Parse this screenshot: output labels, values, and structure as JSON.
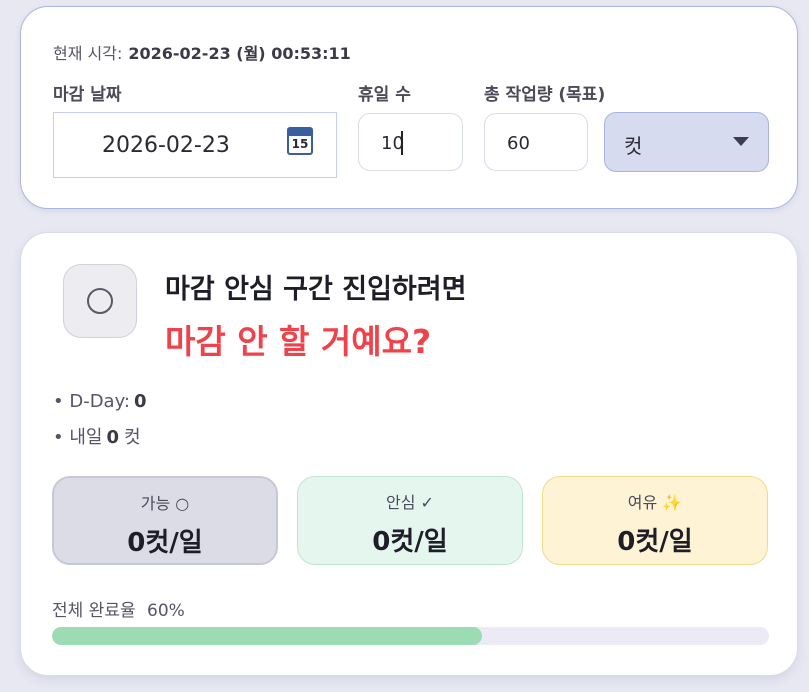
{
  "header": {
    "now_label": "현재 시각:",
    "now_value": "2026-02-23 (월) 00:53:11"
  },
  "form": {
    "deadline_label": "마감 날짜",
    "deadline_value": "2026-02-23",
    "calendar_day": "15",
    "holidays_label": "휴일 수",
    "holidays_value": "10",
    "total_label": "총 작업량 (목표)",
    "total_value": "60",
    "unit_value": "컷"
  },
  "status": {
    "headline": "마감 안심 구간 진입하려면",
    "subhead": "마감 안 할 거예요?",
    "dday_label": "• D-Day:",
    "dday_value": "0",
    "tomorrow_label": "• 내일",
    "tomorrow_value": "0",
    "tomorrow_unit": "컷"
  },
  "rates": [
    {
      "label": "가능 ○",
      "value": "0컷/일"
    },
    {
      "label": "안심 ✓",
      "value": "0컷/일"
    },
    {
      "label": "여유 ✨",
      "value": "0컷/일"
    }
  ],
  "progress": {
    "label": "전체 완료율",
    "percent_text": "60%",
    "percent": 60
  },
  "colors": {
    "accent_red": "#f0424a",
    "progress_fill": "#9bdcb4",
    "select_bg": "#d6dbf0"
  },
  "icons": {
    "calendar": "calendar-icon",
    "dropdown": "chevron-down-icon",
    "status": "circle-icon"
  }
}
